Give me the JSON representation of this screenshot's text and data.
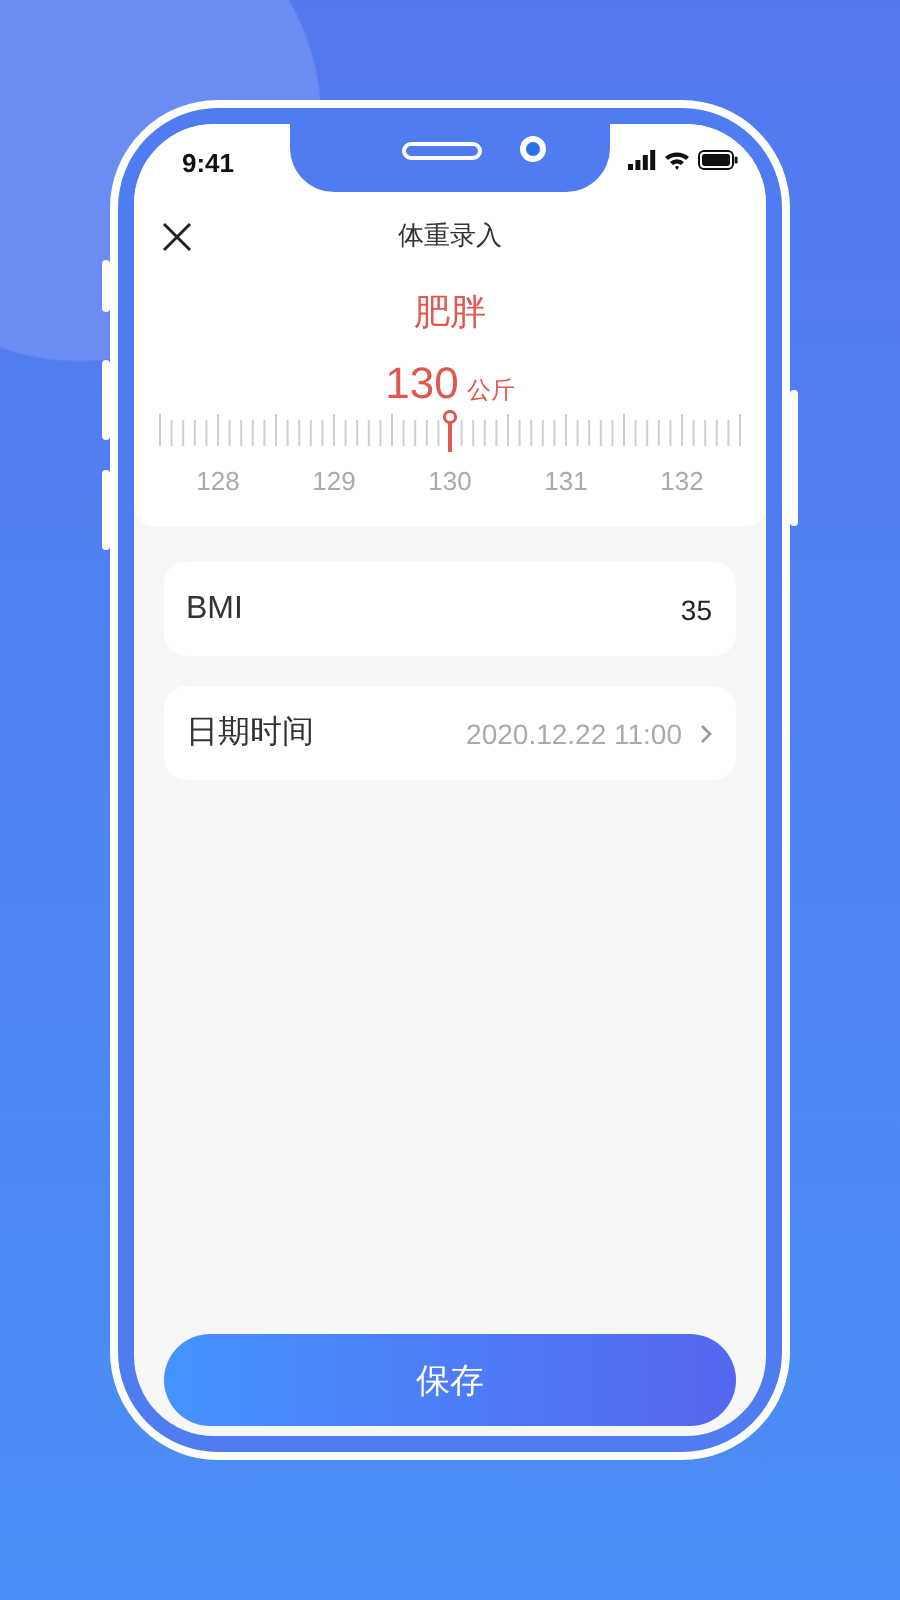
{
  "status_bar": {
    "time": "9:41"
  },
  "nav": {
    "title": "体重录入"
  },
  "weight": {
    "category": "肥胖",
    "value": "130",
    "unit": "公斤",
    "ruler_labels": [
      "128",
      "129",
      "130",
      "131",
      "132"
    ]
  },
  "fields": [
    {
      "kind": "static",
      "label": "BMI",
      "value": "35"
    },
    {
      "kind": "picker",
      "label": "日期时间",
      "value": "2020.12.22 11:00"
    }
  ],
  "save_button": "保存"
}
